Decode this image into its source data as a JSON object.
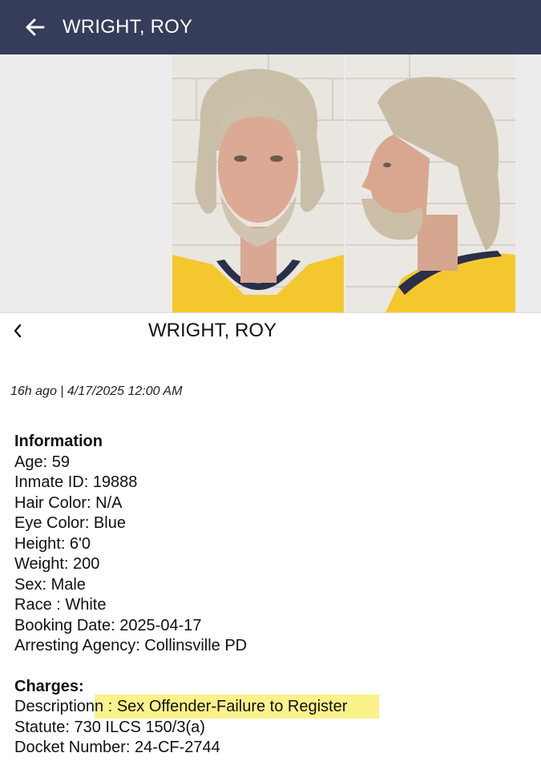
{
  "appbar": {
    "title": "WRIGHT, ROY"
  },
  "detail": {
    "title": "WRIGHT, ROY",
    "timestamp": "16h ago | 4/17/2025 12:00 AM"
  },
  "information": {
    "heading": "Information",
    "age": "Age: 59",
    "inmate_id": "Inmate ID: 19888",
    "hair_color": "Hair Color: N/A",
    "eye_color": "Eye Color: Blue",
    "height": "Height: 6'0",
    "weight": "Weight: 200",
    "sex": "Sex: Male",
    "race": "Race : White",
    "booking_date": "Booking Date: 2025-04-17",
    "arresting_agency": "Arresting Agency: Collinsville PD"
  },
  "charges": {
    "heading": "Charges:",
    "description_prefix": "Description",
    "description_highlighted": "n : Sex Offender-Failure to Register",
    "statute": "Statute: 730 ILCS 150/3(a)",
    "docket": "Docket Number: 24-CF-2744"
  },
  "icons": {
    "back": "arrow-left-icon",
    "prev": "chevron-left-icon"
  },
  "colors": {
    "appbar": "#353d5a",
    "highlight": "#fbf28a",
    "shirt": "#f5c72e"
  }
}
